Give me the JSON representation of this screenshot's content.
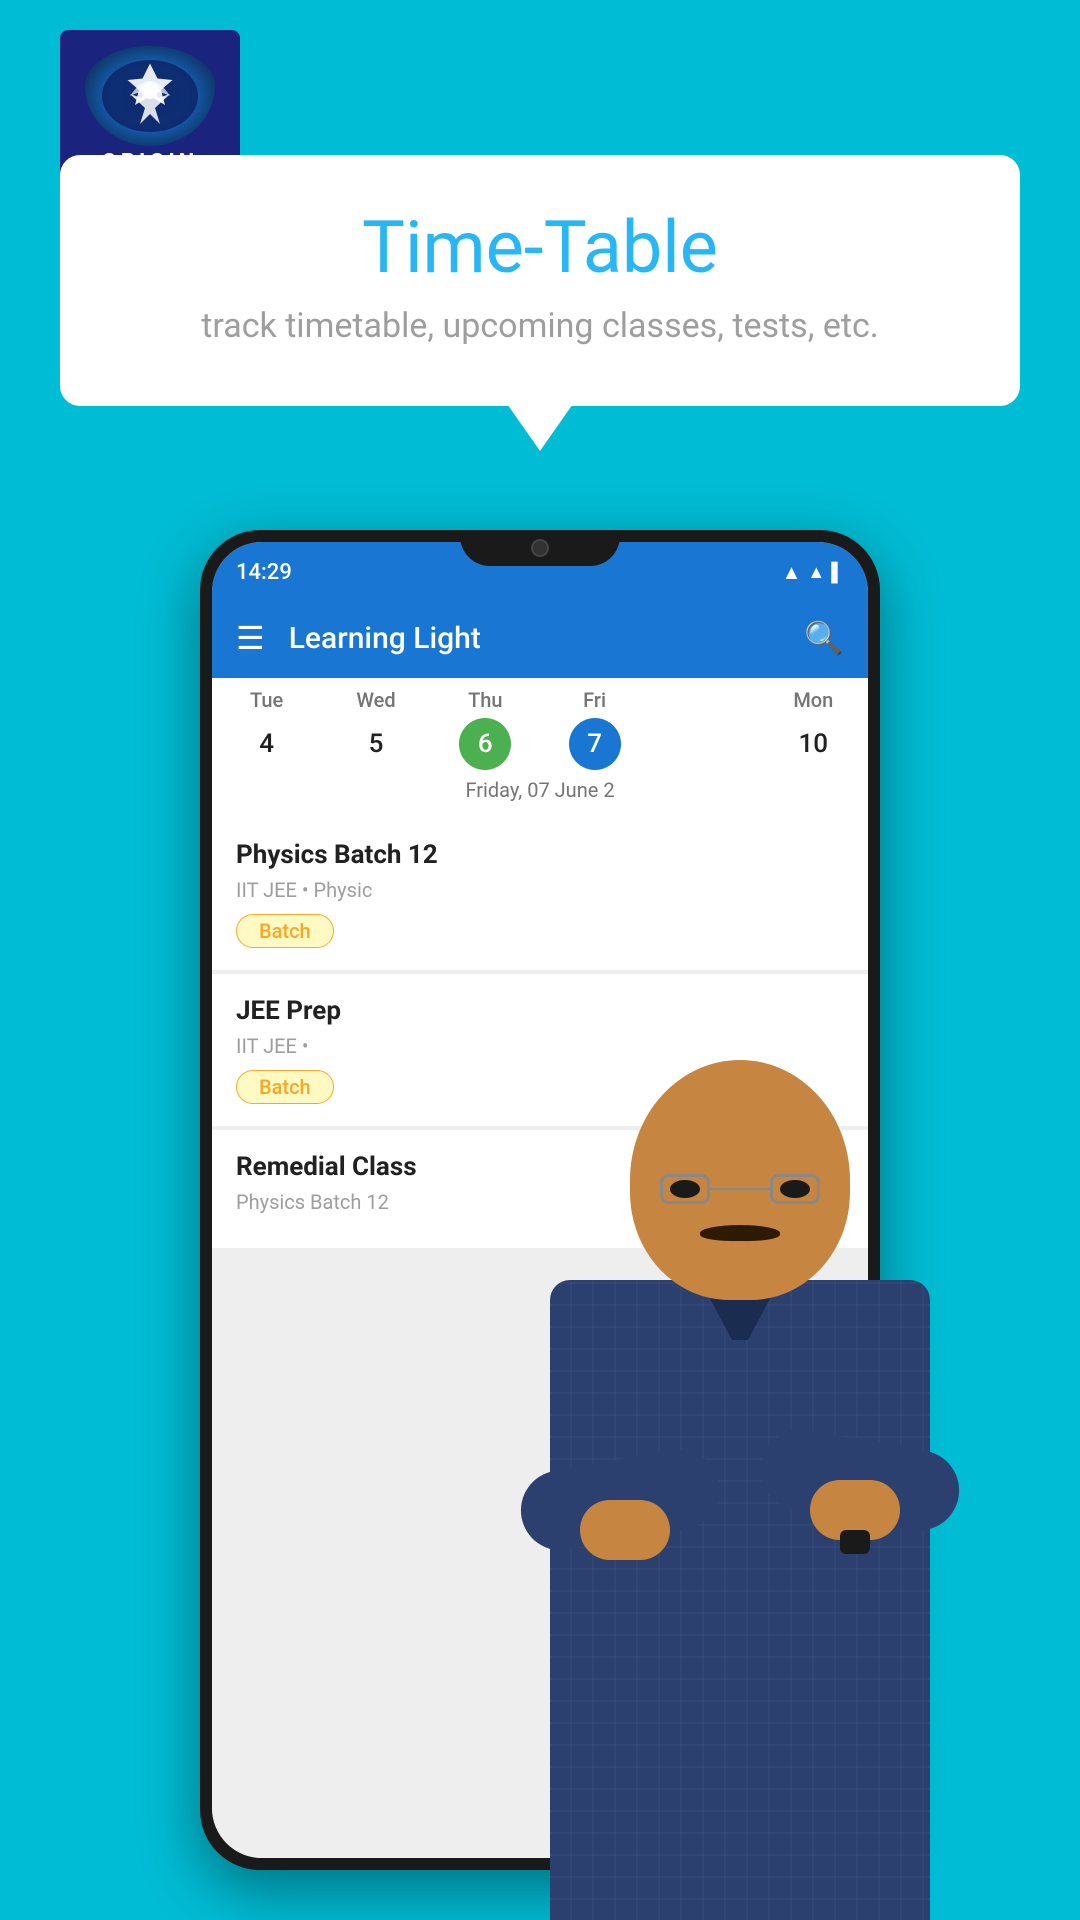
{
  "app": {
    "bg_color": "#00BCD4"
  },
  "logo": {
    "text": "ORIGIN",
    "tm": "™"
  },
  "bubble": {
    "title": "Time-Table",
    "subtitle": "track timetable, upcoming classes, tests, etc."
  },
  "phone": {
    "status_time": "14:29",
    "app_title": "Learning Light",
    "hamburger_label": "☰",
    "search_label": "🔍",
    "selected_date_label": "Friday, 07 June 2",
    "calendar": {
      "days": [
        {
          "name": "Tue",
          "num": "4",
          "state": "normal"
        },
        {
          "name": "Wed",
          "num": "5",
          "state": "normal"
        },
        {
          "name": "Thu",
          "num": "6",
          "state": "green"
        },
        {
          "name": "Fri",
          "num": "7",
          "state": "blue"
        },
        {
          "name": "",
          "num": "",
          "state": "empty"
        },
        {
          "name": "Mon",
          "num": "10",
          "state": "normal"
        }
      ]
    },
    "schedule": [
      {
        "title": "Physics Batch 12",
        "meta": "IIT JEE • Physic",
        "badge": "Batch"
      },
      {
        "title": "JEE Prep",
        "meta": "IIT JEE •",
        "badge": "Batch"
      },
      {
        "title": "Remedial Class",
        "meta": "Physics Batch 12",
        "badge": ""
      }
    ]
  }
}
